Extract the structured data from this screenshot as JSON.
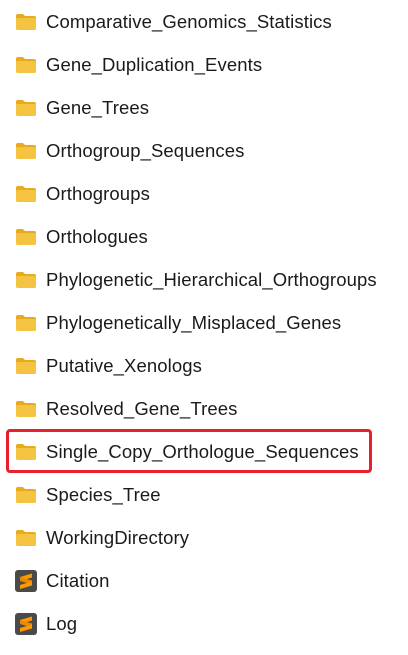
{
  "files": [
    {
      "label": "Comparative_Genomics_Statistics",
      "type": "folder",
      "icon": "folder-icon"
    },
    {
      "label": "Gene_Duplication_Events",
      "type": "folder",
      "icon": "folder-icon"
    },
    {
      "label": "Gene_Trees",
      "type": "folder",
      "icon": "folder-icon"
    },
    {
      "label": "Orthogroup_Sequences",
      "type": "folder",
      "icon": "folder-icon"
    },
    {
      "label": "Orthogroups",
      "type": "folder",
      "icon": "folder-icon"
    },
    {
      "label": "Orthologues",
      "type": "folder",
      "icon": "folder-icon"
    },
    {
      "label": "Phylogenetic_Hierarchical_Orthogroups",
      "type": "folder",
      "icon": "folder-icon"
    },
    {
      "label": "Phylogenetically_Misplaced_Genes",
      "type": "folder",
      "icon": "folder-icon"
    },
    {
      "label": "Putative_Xenologs",
      "type": "folder",
      "icon": "folder-icon"
    },
    {
      "label": "Resolved_Gene_Trees",
      "type": "folder",
      "icon": "folder-icon"
    },
    {
      "label": "Single_Copy_Orthologue_Sequences",
      "type": "folder",
      "icon": "folder-icon",
      "highlighted": true
    },
    {
      "label": "Species_Tree",
      "type": "folder",
      "icon": "folder-icon"
    },
    {
      "label": "WorkingDirectory",
      "type": "folder",
      "icon": "folder-icon"
    },
    {
      "label": "Citation",
      "type": "file",
      "icon": "sublime-text-icon"
    },
    {
      "label": "Log",
      "type": "file",
      "icon": "sublime-text-icon"
    }
  ],
  "colors": {
    "folder_body": "#f5c342",
    "folder_tab": "#e9a91e",
    "highlight_border": "#e8202a",
    "sublime_bg": "#4a4a4a",
    "sublime_accent": "#ff9800"
  }
}
